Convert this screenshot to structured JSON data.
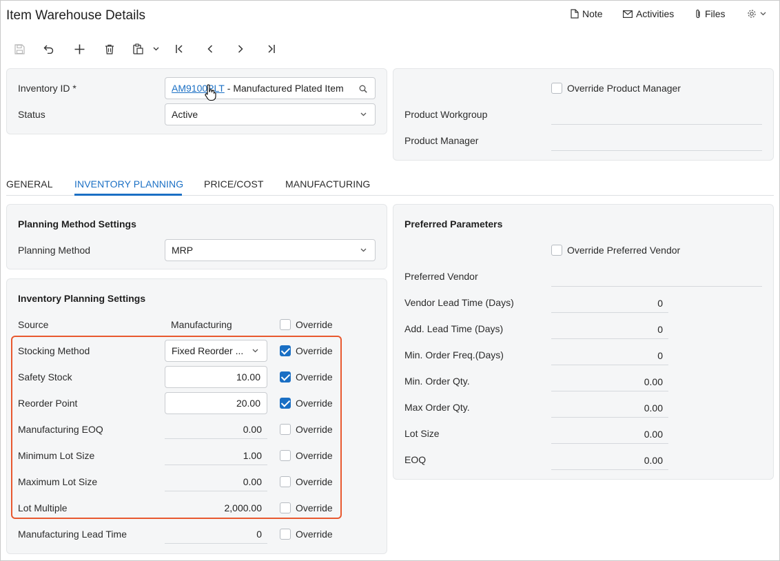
{
  "header": {
    "title": "Item Warehouse Details",
    "note": "Note",
    "activities": "Activities",
    "files": "Files"
  },
  "summary": {
    "inventory_id_label": "Inventory ID *",
    "inventory_id_value": "AM9100PLT",
    "inventory_id_desc": "- Manufactured Plated Item",
    "status_label": "Status",
    "status_value": "Active",
    "override_pm_label": "Override Product Manager",
    "product_workgroup_label": "Product Workgroup",
    "product_manager_label": "Product Manager"
  },
  "tabs": [
    {
      "label": "GENERAL"
    },
    {
      "label": "INVENTORY PLANNING"
    },
    {
      "label": "PRICE/COST"
    },
    {
      "label": "MANUFACTURING"
    }
  ],
  "planning_method": {
    "title": "Planning Method Settings",
    "label": "Planning Method",
    "value": "MRP"
  },
  "inventory_planning": {
    "title": "Inventory Planning Settings",
    "source_label": "Source",
    "source_value": "Manufacturing",
    "override_text": "Override",
    "rows": [
      {
        "label": "Stocking Method",
        "value": "Fixed Reorder ..."
      },
      {
        "label": "Safety Stock",
        "value": "10.00"
      },
      {
        "label": "Reorder Point",
        "value": "20.00"
      },
      {
        "label": "Manufacturing EOQ",
        "value": "0.00"
      },
      {
        "label": "Minimum Lot Size",
        "value": "1.00"
      },
      {
        "label": "Maximum Lot Size",
        "value": "0.00"
      },
      {
        "label": "Lot Multiple",
        "value": "2,000.00"
      },
      {
        "label": "Manufacturing Lead Time",
        "value": "0"
      }
    ]
  },
  "preferred": {
    "title": "Preferred Parameters",
    "override_vendor_label": "Override Preferred Vendor",
    "vendor_label": "Preferred Vendor",
    "rows": [
      {
        "label": "Vendor Lead Time (Days)",
        "value": "0"
      },
      {
        "label": "Add. Lead Time (Days)",
        "value": "0"
      },
      {
        "label": "Min. Order Freq.(Days)",
        "value": "0"
      },
      {
        "label": "Min. Order Qty.",
        "value": "0.00"
      },
      {
        "label": "Max Order Qty.",
        "value": "0.00"
      },
      {
        "label": "Lot Size",
        "value": "0.00"
      },
      {
        "label": "EOQ",
        "value": "0.00"
      }
    ]
  },
  "colors": {
    "accent": "#1a6fc4",
    "highlight": "#e8582e"
  }
}
